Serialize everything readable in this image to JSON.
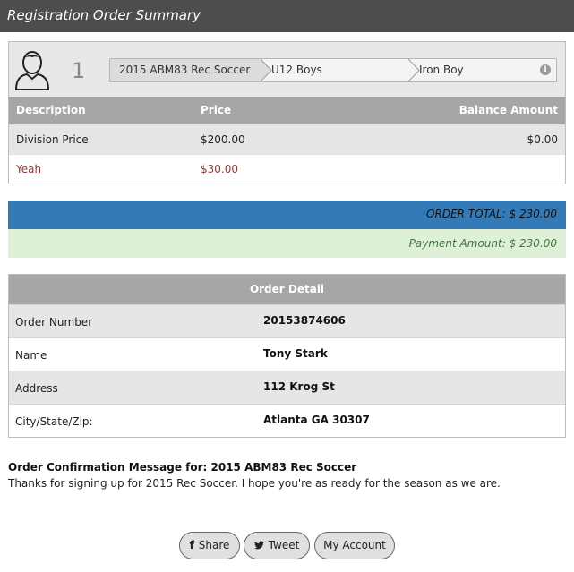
{
  "header": {
    "title": "Registration Order Summary"
  },
  "registration": {
    "player_number": "1",
    "breadcrumb": [
      "2015 ABM83 Rec Soccer",
      "U12 Boys",
      "Iron Boy"
    ],
    "info_icon": "info-icon",
    "table": {
      "headers": {
        "description": "Description",
        "price": "Price",
        "balance": "Balance Amount"
      },
      "rows": [
        {
          "description": "Division Price",
          "price": "$200.00",
          "balance": "$0.00"
        },
        {
          "description": "Yeah",
          "price": "$30.00",
          "balance": ""
        }
      ]
    }
  },
  "totals": {
    "order_total": "ORDER TOTAL: $ 230.00",
    "payment_amount": "Payment Amount: $ 230.00"
  },
  "order_detail": {
    "title": "Order Detail",
    "rows": [
      {
        "label": "Order Number",
        "value": "20153874606"
      },
      {
        "label": "Name",
        "value": "Tony Stark"
      },
      {
        "label": "Address",
        "value": "112 Krog St"
      },
      {
        "label": "City/State/Zip:",
        "value": "Atlanta GA 30307"
      }
    ]
  },
  "confirmation": {
    "title": "Order Confirmation Message for: 2015 ABM83 Rec Soccer",
    "message": "Thanks for signing up for 2015 Rec Soccer. I hope you're as ready for the season as we are."
  },
  "buttons": {
    "share": "Share",
    "tweet": "Tweet",
    "account": "My Account"
  },
  "colors": {
    "header_bg": "#4d4d4d",
    "table_header_bg": "#a6a6a6",
    "order_total_bg": "#337ab7",
    "payment_bg": "#dff0d8",
    "payment_text": "#3c763d",
    "extra_item_text": "#8a3b3b"
  }
}
